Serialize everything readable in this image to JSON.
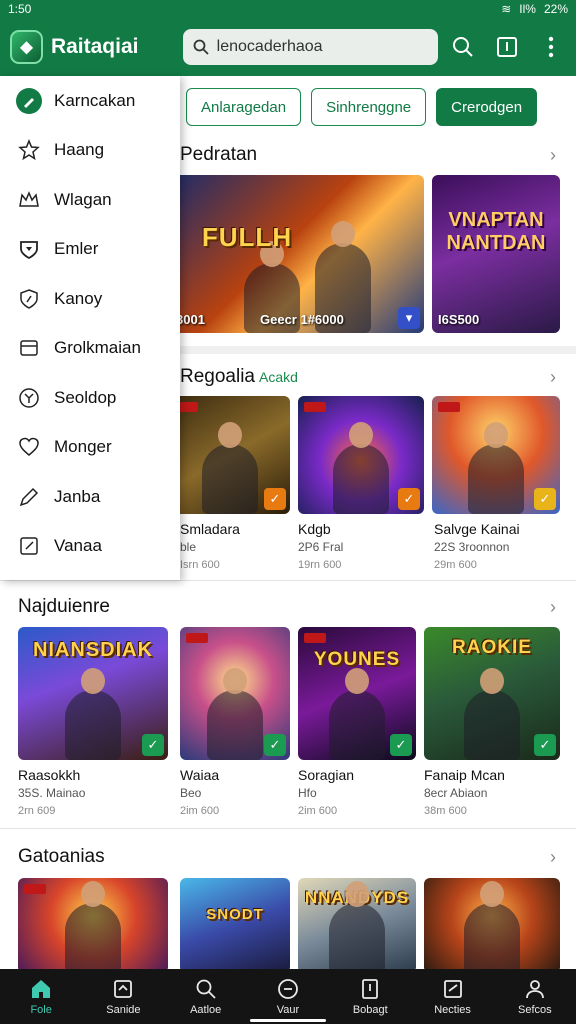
{
  "status": {
    "time": "1:50",
    "battery": "22%",
    "signal": "Il%"
  },
  "appbar": {
    "brand": "Raitaqiai",
    "search_value": "lenocaderhaoa"
  },
  "filters": {
    "chips": [
      "Anlaragedan",
      "Sinhrenggne",
      "Crerodgen"
    ]
  },
  "drawer": {
    "items": [
      {
        "label": "Karncakan",
        "icon": "pen-icon"
      },
      {
        "label": "Haang",
        "icon": "star-icon"
      },
      {
        "label": "Wlagan",
        "icon": "crown-icon"
      },
      {
        "label": "Emler",
        "icon": "heart-shield-icon"
      },
      {
        "label": "Kanoy",
        "icon": "shield-icon"
      },
      {
        "label": "Grolkmaian",
        "icon": "wallet-icon"
      },
      {
        "label": "Seoldop",
        "icon": "compass-icon"
      },
      {
        "label": "Monger",
        "icon": "heart-icon"
      },
      {
        "label": "Janba",
        "icon": "pencil-icon"
      },
      {
        "label": "Vanaa",
        "icon": "edit-box-icon"
      }
    ]
  },
  "sections": {
    "featured": {
      "title": "Pedratan",
      "games": [
        {
          "art_text": "FULLH",
          "price": "3001"
        },
        {
          "art_text": "",
          "price": "Geecr 1#6000"
        },
        {
          "art_text": "VNAPTAN NANTDAN",
          "price": "I6S500"
        }
      ]
    },
    "regular": {
      "title": "Regoalia",
      "tag": "Acakd",
      "games": [
        {
          "name": "Smladara",
          "sub": "ble",
          "meta": "Isrn 600",
          "badge": "orange"
        },
        {
          "name": "Kdgb",
          "sub": "2P6 Fral",
          "meta": "19rn 600",
          "badge": "orange"
        },
        {
          "name": "Salvge Kainai",
          "sub": "22S 3roonnon",
          "meta": "29m 600",
          "badge": "yellow"
        }
      ]
    },
    "nayjouienre": {
      "title": "Najduienre",
      "games": [
        {
          "name": "Raasokkh",
          "sub": "35S. Mainao",
          "meta": "2rn 609",
          "art_text": "NIANSDIAK",
          "badge": "green"
        },
        {
          "name": "Waiaa",
          "sub": "Beo",
          "meta": "2im 600",
          "art_text": "",
          "badge": "green"
        },
        {
          "name": "Soragian",
          "sub": "Hfo",
          "meta": "2im 600",
          "art_text": "YOUNES",
          "badge": "green"
        },
        {
          "name": "Fanaip Mcan",
          "sub": "8ecr Abiaon",
          "meta": "38m 600",
          "art_text": "RAOKIE",
          "badge": "green"
        }
      ]
    },
    "categories": {
      "title": "Gatoanias",
      "games": [
        {
          "art_text": ""
        },
        {
          "art_text": "SNODT"
        },
        {
          "art_text": "NNANDYDS"
        },
        {
          "art_text": ""
        }
      ]
    }
  },
  "bottomnav": {
    "items": [
      {
        "label": "Fole",
        "icon": "home-icon",
        "active": true
      },
      {
        "label": "Sanide",
        "icon": "inbox-icon"
      },
      {
        "label": "Aatloe",
        "icon": "search-icon"
      },
      {
        "label": "Vaur",
        "icon": "compass-icon"
      },
      {
        "label": "Bobagt",
        "icon": "book-icon"
      },
      {
        "label": "Necties",
        "icon": "news-icon"
      },
      {
        "label": "Sefcos",
        "icon": "profile-icon"
      }
    ]
  },
  "colors": {
    "brand": "#117a45",
    "nav_active": "#3fc9b0",
    "navbar": "#141414"
  }
}
